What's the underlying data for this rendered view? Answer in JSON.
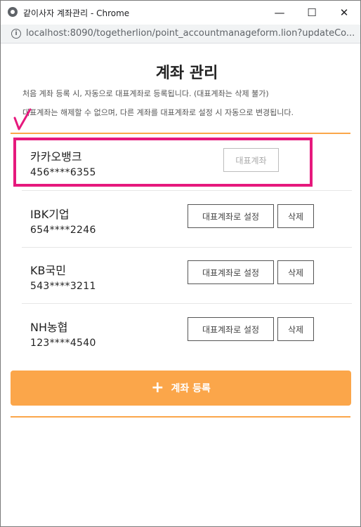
{
  "window": {
    "title": "같이사자 계좌관리 - Chrome",
    "url": "localhost:8090/togetherlion/point_accountmanageform.lion?updateCo...",
    "minimize": "—",
    "maximize": "☐",
    "close": "✕"
  },
  "page": {
    "title": "계좌 관리",
    "note1": "처음 계좌 등록 시, 자동으로 대표계좌로 등록됩니다. (대표계좌는 삭제 불가)",
    "note2": "대표계좌는 해제할 수 없으며, 다른 계좌를 대표계좌로 설정 시 자동으로 변경됩니다."
  },
  "accounts": [
    {
      "bank": "카카오뱅크",
      "number": "456****6355",
      "primary_label": "대표계좌"
    },
    {
      "bank": "IBK기업",
      "number": "654****2246",
      "set_label": "대표계좌로 설정",
      "delete_label": "삭제"
    },
    {
      "bank": "KB국민",
      "number": "543****3211",
      "set_label": "대표계좌로 설정",
      "delete_label": "삭제"
    },
    {
      "bank": "NH농협",
      "number": "123****4540",
      "set_label": "대표계좌로 설정",
      "delete_label": "삭제"
    }
  ],
  "add_button": {
    "icon": "+",
    "label": "계좌 등록"
  },
  "colors": {
    "accent": "#fba64a",
    "highlight": "#e6197d"
  }
}
